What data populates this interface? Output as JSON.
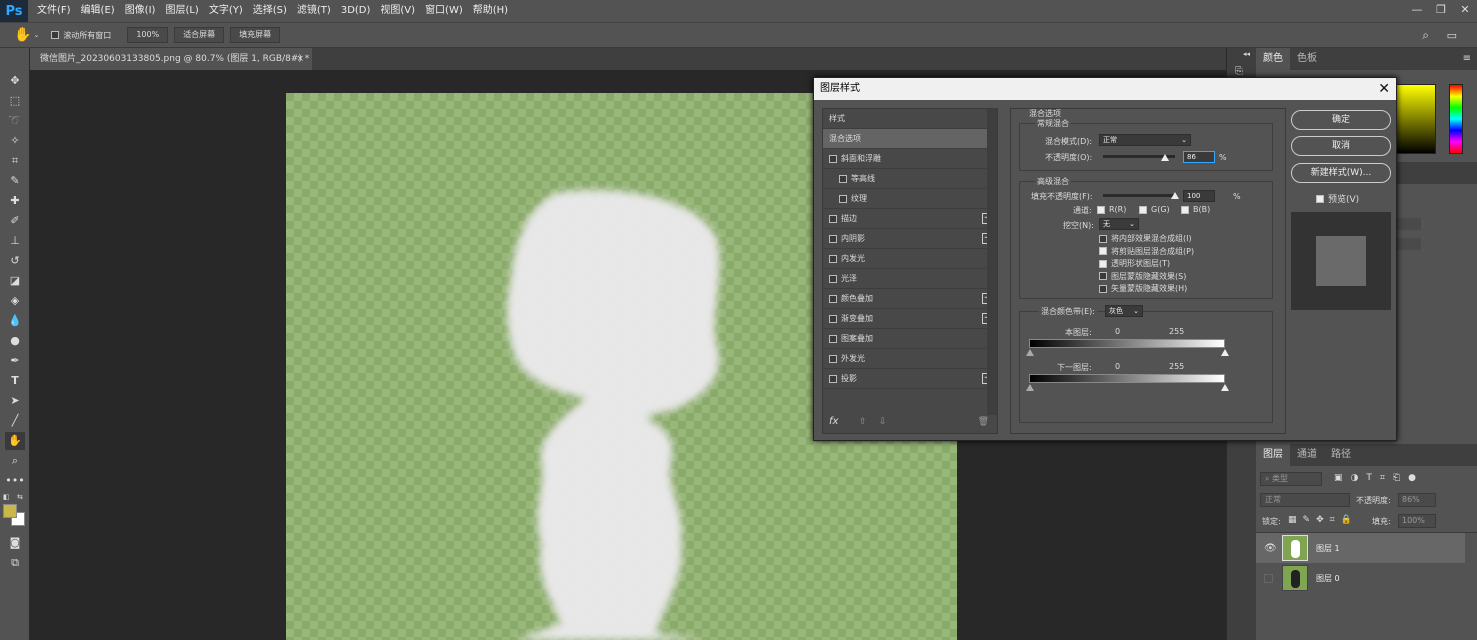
{
  "app": {
    "logo": "Ps",
    "window_controls": [
      "—",
      "❐",
      "✕"
    ]
  },
  "menu": [
    "文件(F)",
    "编辑(E)",
    "图像(I)",
    "图层(L)",
    "文字(Y)",
    "选择(S)",
    "滤镜(T)",
    "3D(D)",
    "视图(V)",
    "窗口(W)",
    "帮助(H)"
  ],
  "options": {
    "scroll_all": "滚动所有窗口",
    "zoom": "100%",
    "fit_screen": "适合屏幕",
    "fill_screen": "填充屏幕"
  },
  "document": {
    "tab": "微信图片_20230603133805.png @ 80.7% (图层 1, RGB/8#) *",
    "close": "×"
  },
  "dialog": {
    "title": "图层样式",
    "close": "✕",
    "styles_header": "样式",
    "styles": [
      {
        "label": "混合选项",
        "check": false,
        "plus": false,
        "selected": true,
        "indent": false,
        "hascb": false
      },
      {
        "label": "斜面和浮雕",
        "check": false,
        "plus": false,
        "selected": false,
        "indent": false,
        "hascb": true
      },
      {
        "label": "等高线",
        "check": false,
        "plus": false,
        "selected": false,
        "indent": true,
        "hascb": true
      },
      {
        "label": "纹理",
        "check": false,
        "plus": false,
        "selected": false,
        "indent": true,
        "hascb": true
      },
      {
        "label": "描边",
        "check": false,
        "plus": true,
        "selected": false,
        "indent": false,
        "hascb": true
      },
      {
        "label": "内阴影",
        "check": false,
        "plus": true,
        "selected": false,
        "indent": false,
        "hascb": true
      },
      {
        "label": "内发光",
        "check": false,
        "plus": false,
        "selected": false,
        "indent": false,
        "hascb": true
      },
      {
        "label": "光泽",
        "check": false,
        "plus": false,
        "selected": false,
        "indent": false,
        "hascb": true
      },
      {
        "label": "颜色叠加",
        "check": false,
        "plus": true,
        "selected": false,
        "indent": false,
        "hascb": true
      },
      {
        "label": "渐变叠加",
        "check": false,
        "plus": true,
        "selected": false,
        "indent": false,
        "hascb": true
      },
      {
        "label": "图案叠加",
        "check": false,
        "plus": false,
        "selected": false,
        "indent": false,
        "hascb": true
      },
      {
        "label": "外发光",
        "check": false,
        "plus": false,
        "selected": false,
        "indent": false,
        "hascb": true
      },
      {
        "label": "投影",
        "check": false,
        "plus": true,
        "selected": false,
        "indent": false,
        "hascb": true
      }
    ],
    "fx": "fx",
    "blend_options": "混合选项",
    "general_blend": "常规混合",
    "blend_mode_label": "混合模式(D):",
    "blend_mode": "正常",
    "opacity_label": "不透明度(O):",
    "opacity": "86",
    "opacity_fraction": 0.86,
    "percent": "%",
    "advanced_blend": "高级混合",
    "fill_opacity_label": "填充不透明度(F):",
    "fill_opacity": "100",
    "fill_fraction": 1.0,
    "channels_label": "通道:",
    "channel_r": "R(R)",
    "channel_g": "G(G)",
    "channel_b": "B(B)",
    "knockout_label": "挖空(N):",
    "knockout": "无",
    "adv_checks": [
      {
        "label": "将内部效果混合成组(I)",
        "on": false
      },
      {
        "label": "将剪贴图层混合成组(P)",
        "on": true
      },
      {
        "label": "透明形状图层(T)",
        "on": true
      },
      {
        "label": "图层蒙版隐藏效果(S)",
        "on": false
      },
      {
        "label": "矢量蒙版隐藏效果(H)",
        "on": false
      }
    ],
    "blend_if_label": "混合颜色带(E):",
    "blend_if": "灰色",
    "this_layer": "本图层:",
    "underlying": "下一图层:",
    "min": "0",
    "max": "255",
    "ok": "确定",
    "cancel": "取消",
    "new_style": "新建样式(W)...",
    "preview": "预览(V)"
  },
  "right_panel": {
    "tabs_top": [
      "颜色",
      "色板"
    ],
    "tabs_layers": [
      "图层",
      "通道",
      "路径"
    ],
    "kind": "类型",
    "blend": "正常",
    "opacity_label": "不透明度:",
    "opacity": "86%",
    "lock_label": "锁定:",
    "fill_label": "填充:",
    "fill": "100%",
    "layers": [
      {
        "name": "图层 1",
        "visible": true,
        "selected": true
      },
      {
        "name": "图层 0",
        "visible": false,
        "selected": false
      }
    ]
  },
  "colors": {
    "accent": "#31a8ff",
    "foreground": "#c8b84a",
    "background": "#ffffff",
    "canvas_green": "#8aaa6a"
  }
}
